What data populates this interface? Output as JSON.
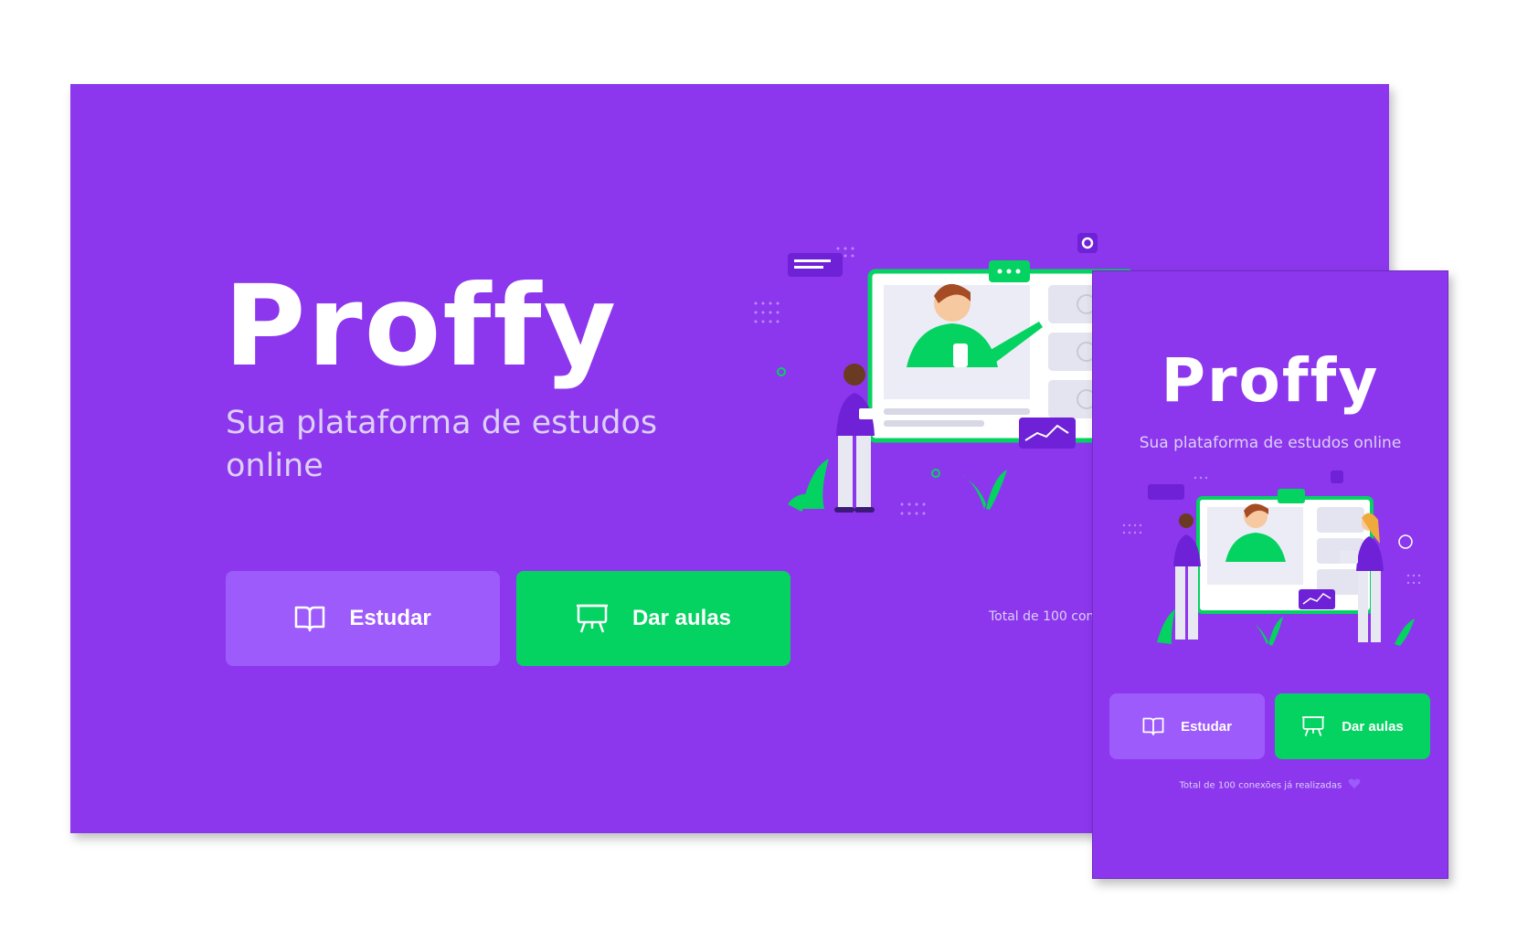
{
  "app": {
    "logo_text": "Proffy",
    "tagline": "Sua plataforma de estudos online"
  },
  "buttons": {
    "study_label": "Estudar",
    "give_classes_label": "Dar aulas"
  },
  "footer": {
    "total_connections_text": "Total de 100 conexões já realizadas",
    "desktop_visible_text": "Total de 100 con"
  },
  "colors": {
    "primary": "#8c37ed",
    "primary_light": "#9d5bfb",
    "secondary": "#04d361",
    "text_in_primary": "#ddd0f7"
  },
  "icons": {
    "study": "book-icon",
    "give_classes": "presentation-board-icon",
    "heart": "purple-heart-icon"
  }
}
